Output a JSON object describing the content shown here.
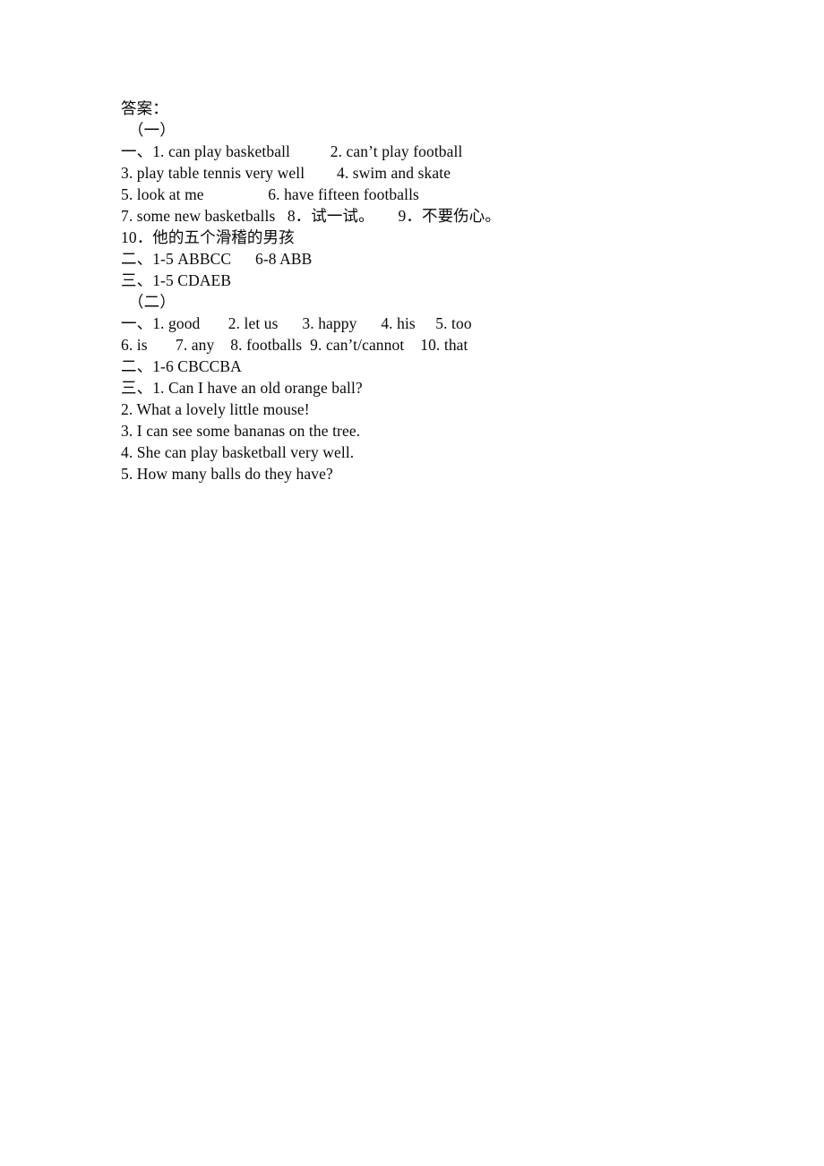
{
  "document": {
    "title": "答案：",
    "sections": [
      {
        "heading": "（一）",
        "lines": [
          "一、1. can play basketball          2. can’t play football",
          "3. play table tennis very well        4. swim and skate",
          "5. look at me                6. have fifteen footballs",
          "7. some new basketballs   8．试一试。      9．不要伤心。",
          "10．他的五个滑稽的男孩",
          "二、1-5 ABBCC      6-8 ABB",
          "三、1-5 CDAEB"
        ]
      },
      {
        "heading": "（二）",
        "lines": [
          "一、1. good       2. let us      3. happy      4. his     5. too",
          "6. is       7. any    8. footballs  9. can’t/cannot    10. that",
          "二、1-6 CBCCBA",
          "三、1. Can I have an old orange ball?",
          "2. What a lovely little mouse!",
          "3. I can see some bananas on the tree.",
          "4. She can play basketball very well.",
          "5. How many balls do they have?"
        ]
      }
    ]
  }
}
